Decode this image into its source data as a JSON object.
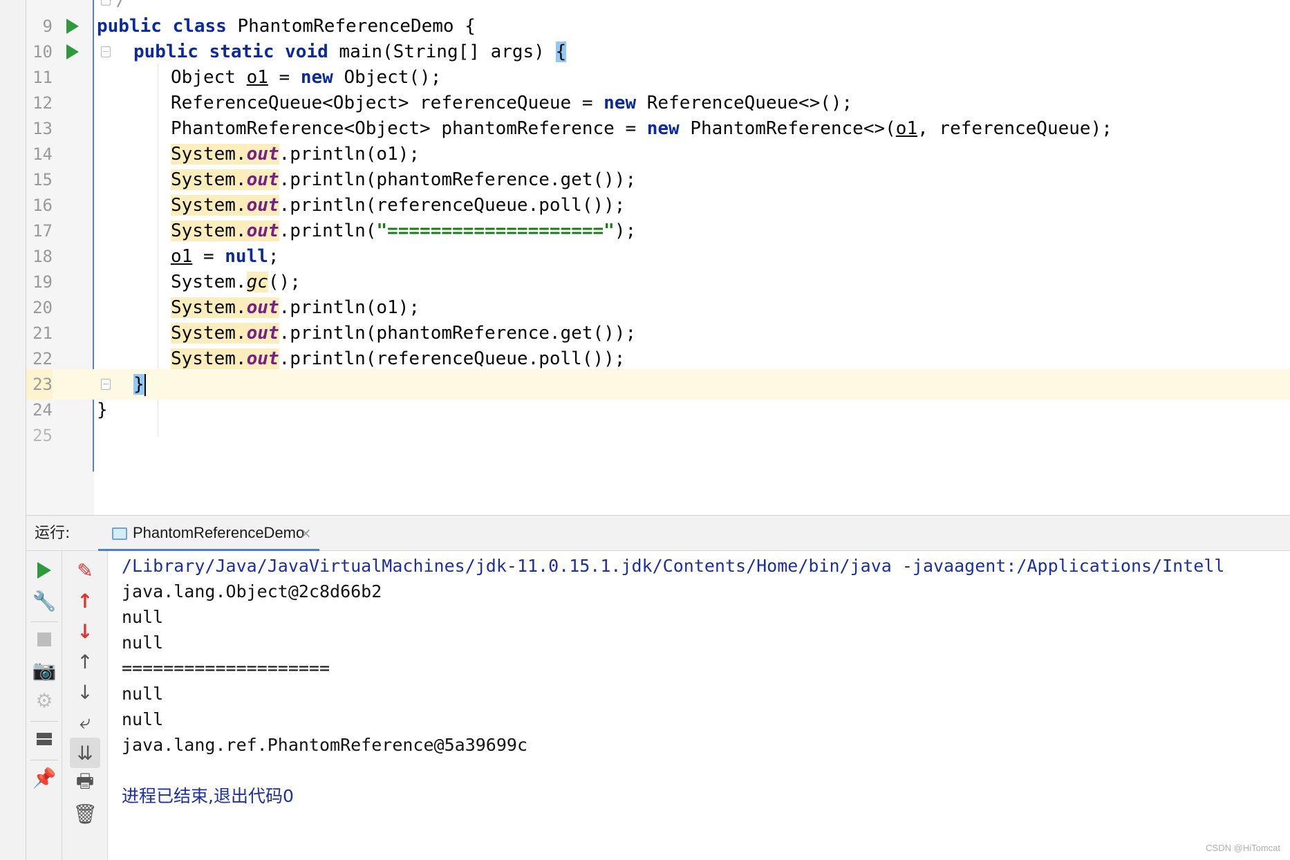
{
  "editor": {
    "lines": [
      {
        "num": "9",
        "text": "public class PhantomReferenceDemo {"
      },
      {
        "num": "10",
        "text": "public static void main(String[] args) {"
      },
      {
        "num": "11",
        "text": "Object o1 = new Object();"
      },
      {
        "num": "12",
        "text": "ReferenceQueue<Object> referenceQueue = new ReferenceQueue<>();"
      },
      {
        "num": "13",
        "text": "PhantomReference<Object> phantomReference = new PhantomReference<>(o1, referenceQueue);"
      },
      {
        "num": "14",
        "text": "System.out.println(o1);"
      },
      {
        "num": "15",
        "text": "System.out.println(phantomReference.get());"
      },
      {
        "num": "16",
        "text": "System.out.println(referenceQueue.poll());"
      },
      {
        "num": "17",
        "text": "System.out.println(\"====================\");"
      },
      {
        "num": "18",
        "text": "o1 = null;"
      },
      {
        "num": "19",
        "text": "System.gc();"
      },
      {
        "num": "20",
        "text": "System.out.println(o1);"
      },
      {
        "num": "21",
        "text": "System.out.println(phantomReference.get());"
      },
      {
        "num": "22",
        "text": "System.out.println(referenceQueue.poll());"
      },
      {
        "num": "23",
        "text": "}"
      },
      {
        "num": "24",
        "text": "}"
      }
    ],
    "current_line": "23"
  },
  "run_panel": {
    "label": "运行:",
    "tab_name": "PhantomReferenceDemo",
    "close_glyph": "×"
  },
  "console": {
    "lines": [
      "/Library/Java/JavaVirtualMachines/jdk-11.0.15.1.jdk/Contents/Home/bin/java -javaagent:/Applications/Intell",
      "java.lang.Object@2c8d66b2",
      "null",
      "null",
      "====================",
      "null",
      "null",
      "java.lang.ref.PhantomReference@5a39699c",
      "",
      "进程已结束,退出代码0"
    ]
  },
  "toolbar_left": [
    "run-icon",
    "wrench-icon",
    "stop-icon",
    "camera-icon",
    "debug-settings-icon",
    "layout-icon",
    "pin-icon"
  ],
  "toolbar_right": [
    "clear-icon",
    "up-red-icon",
    "down-red-icon",
    "up-icon",
    "down-icon",
    "soft-wrap-icon",
    "scroll-to-end-icon",
    "print-icon",
    "trash-icon"
  ],
  "watermark": "CSDN @HiTomcat",
  "colors": {
    "keyword": "#0b2a9e",
    "static_field": "#791f82",
    "string": "#1c7a1c",
    "run_green": "#2f9a3c",
    "console_system": "#1a2fa8",
    "current_line": "#fef9e2",
    "highlight": "#fbeebc"
  }
}
